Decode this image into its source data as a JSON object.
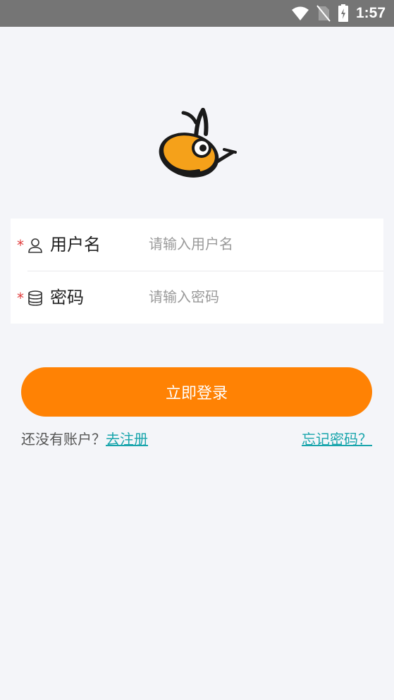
{
  "status_bar": {
    "time": "1:57",
    "icons": [
      "wifi-icon",
      "no-sim-icon",
      "battery-charging-icon"
    ]
  },
  "logo": {
    "icon": "bee-mascot-logo"
  },
  "form": {
    "username": {
      "required_mark": "*",
      "icon": "user-icon",
      "label": "用户名",
      "placeholder": "请输入用户名",
      "value": ""
    },
    "password": {
      "required_mark": "*",
      "icon": "database-icon",
      "label": "密码",
      "placeholder": "请输入密码",
      "value": ""
    }
  },
  "login_button": {
    "label": "立即登录"
  },
  "footer": {
    "no_account_text": "还没有账户？",
    "register_link": "去注册",
    "forgot_link": "忘记密码？"
  },
  "colors": {
    "accent": "#ff8204",
    "link": "#19a5ac",
    "required": "#e03b3b",
    "background": "#f4f5f9"
  }
}
